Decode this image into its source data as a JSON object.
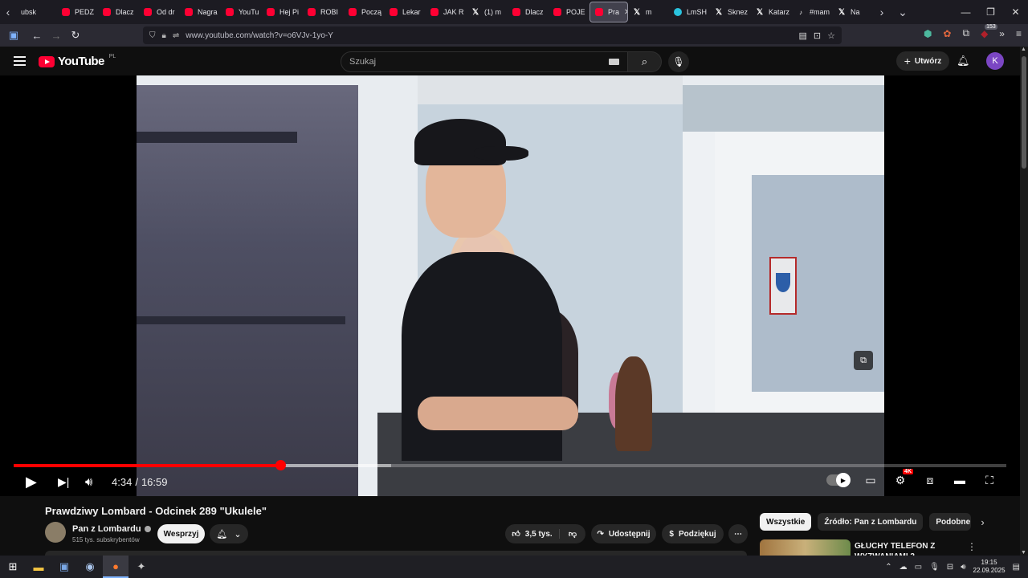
{
  "browser": {
    "tabs": [
      {
        "label": "ubsk",
        "icon": "none"
      },
      {
        "label": "PEDZ",
        "icon": "youtube-icon"
      },
      {
        "label": "Dlacz",
        "icon": "youtube-icon"
      },
      {
        "label": "Od dr",
        "icon": "youtube-icon"
      },
      {
        "label": "Nagra",
        "icon": "youtube-icon"
      },
      {
        "label": "YouTu",
        "icon": "youtube-icon"
      },
      {
        "label": "Hej Pi",
        "icon": "youtube-icon"
      },
      {
        "label": "ROBI",
        "icon": "youtube-icon"
      },
      {
        "label": "Począ",
        "icon": "youtube-icon"
      },
      {
        "label": "Lekar",
        "icon": "youtube-icon"
      },
      {
        "label": "JAK R",
        "icon": "youtube-icon"
      },
      {
        "label": "(1) m",
        "icon": "x-icon"
      },
      {
        "label": "Dlacz",
        "icon": "youtube-icon"
      },
      {
        "label": "POJE",
        "icon": "youtube-icon"
      },
      {
        "label": "Pra",
        "icon": "youtube-icon",
        "active": true
      },
      {
        "label": "m",
        "icon": "x-icon"
      },
      {
        "label": "LmSH",
        "icon": "flag-icon"
      },
      {
        "label": "Sknez",
        "icon": "x-icon"
      },
      {
        "label": "Katarz",
        "icon": "x-icon"
      },
      {
        "label": "#mam",
        "icon": "tiktok-icon"
      },
      {
        "label": "Na",
        "icon": "x-icon"
      }
    ],
    "url": "www.youtube.com/watch?v=o6VJv-1yo-Y",
    "extension_badge": "153"
  },
  "youtube": {
    "logo_text": "YouTube",
    "logo_region": "PL",
    "search_placeholder": "Szukaj",
    "create_label": "Utwórz",
    "avatar_letter": "K",
    "accent": "#ff0000"
  },
  "player": {
    "current_time": "4:34",
    "duration": "16:59",
    "separator": "/",
    "progress": 0.269,
    "buffered": 0.38,
    "quality_badge": "4K"
  },
  "video": {
    "title": "Prawdziwy Lombard - Odcinek 289 \"Ukulele\"",
    "channel": "Pan z Lombardu",
    "subscribers": "515 tys. subskrybentów",
    "support_label": "Wesprzyj",
    "likes": "3,5 tys.",
    "share_label": "Udostępnij",
    "thanks_label": "Podziękuj"
  },
  "sidebar": {
    "chips": [
      {
        "label": "Wszystkie",
        "active": true
      },
      {
        "label": "Źródło: Pan z Lombardu",
        "active": false
      },
      {
        "label": "Podobne",
        "active": false
      }
    ],
    "recommendation_title": "GŁUCHY TELEFON Z WYZWANIAMI 2"
  },
  "taskbar": {
    "time": "19:15",
    "date": "22.09.2025"
  }
}
